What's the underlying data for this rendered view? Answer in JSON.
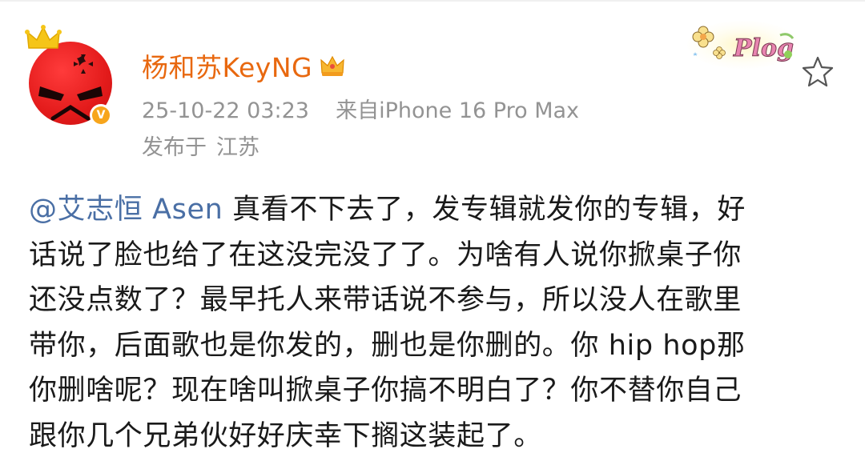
{
  "post": {
    "username": "杨和苏KeyNG",
    "timestamp": "25-10-22 03:23",
    "source": "来自iPhone 16 Pro Max",
    "location_prefix": "发布于",
    "location": "江苏",
    "sticker_text": "Plog",
    "mention": "@艾志恒 Asen",
    "content_lines": [
      " 真看不下去了，发专辑就发你的专辑，好",
      "话说了脸也给了在这没完没了了。为啥有人说你掀桌子你",
      "还没点数了？最早托人来带话说不参与，所以没人在歌里",
      "带你，后面歌也是你发的，删也是你删的。你 hip hop那",
      "你删啥呢？现在啥叫掀桌子你搞不明白了？你不替你自己",
      "跟你几个兄弟伙好好庆幸下搁这装起了。"
    ]
  },
  "icons": {
    "avatar": "angry-face-avatar",
    "crown": "crown-icon",
    "verified": "verified-v-badge",
    "vip": "vip-crown-icon",
    "star": "star-outline-icon"
  },
  "colors": {
    "username": "#e8680f",
    "mention": "#4a6fa5",
    "meta": "#939393",
    "avatar_red": "#e31b1b",
    "verified_orange": "#f7a51c"
  }
}
